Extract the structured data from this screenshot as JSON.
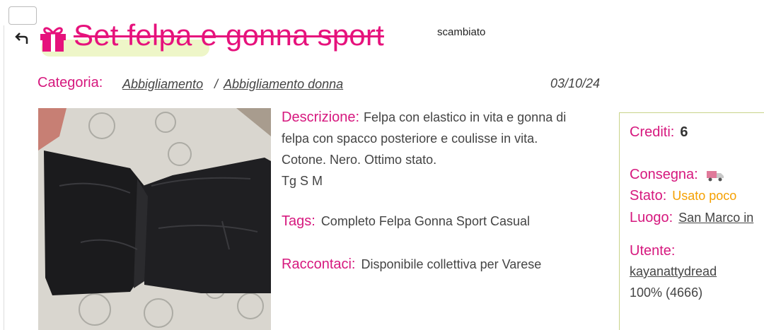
{
  "header": {
    "title": "Set felpa e gonna sport",
    "status": "scambiato",
    "icons": {
      "back": "back-arrow-icon",
      "gift": "gift-icon"
    }
  },
  "meta": {
    "category_label": "Categoria:",
    "category": "Abbigliamento",
    "separator": "/",
    "subcategory": "Abbigliamento donna",
    "date": "03/10/24"
  },
  "details": {
    "description_label": "Descrizione:",
    "description_lines": [
      "Felpa con elastico in vita e gonna di",
      "felpa con spacco posteriore e coulisse in vita.",
      "Cotone. Nero. Ottimo stato.",
      "Tg S M"
    ],
    "tags_label": "Tags:",
    "tags": "Completo Felpa Gonna Sport Casual",
    "contact_label": "Raccontaci:",
    "contact": "Disponibile collettiva per Varese"
  },
  "side": {
    "credits_label": "Crediti:",
    "credits": "6",
    "delivery_label": "Consegna:",
    "delivery_icon": "delivery-truck-icon",
    "state_label": "Stato:",
    "state": "Usato poco",
    "place_label": "Luogo:",
    "place": "San Marco in",
    "user_label": "Utente:",
    "user": "kayanattydread",
    "rating": "100% (4666)"
  },
  "colors": {
    "accent": "#e6127c",
    "label": "#d6187e",
    "state": "#f5a000",
    "panel_border": "#c9d48a"
  }
}
